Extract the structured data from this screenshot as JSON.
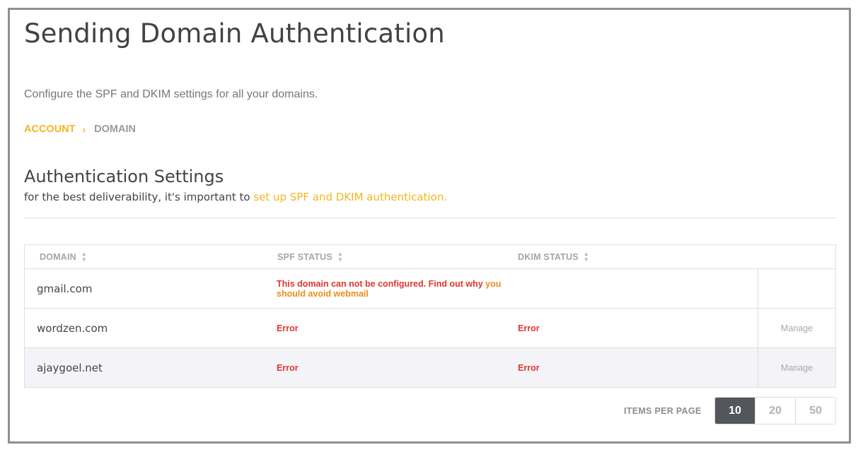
{
  "page": {
    "title": "Sending Domain Authentication",
    "subtitle": "Configure the SPF and DKIM settings for all your domains."
  },
  "breadcrumb": {
    "account": "ACCOUNT",
    "separator": "›",
    "current": "DOMAIN"
  },
  "section": {
    "title": "Authentication Settings",
    "desc_prefix": "for the best deliverability, it's important to ",
    "desc_link": "set up SPF and DKIM authentication."
  },
  "table": {
    "columns": [
      "DOMAIN",
      "SPF STATUS",
      "DKIM STATUS"
    ],
    "sort_icon": "sort-icon",
    "rows": [
      {
        "domain": "gmail.com",
        "spf_text": "This domain can not be configured. Find out why ",
        "spf_link": "you should avoid webmail",
        "dkim": "",
        "manage": ""
      },
      {
        "domain": "wordzen.com",
        "spf_text": "Error",
        "spf_link": "",
        "dkim": "Error",
        "manage": "Manage"
      },
      {
        "domain": "ajaygoel.net",
        "spf_text": "Error",
        "spf_link": "",
        "dkim": "Error",
        "manage": "Manage"
      }
    ]
  },
  "pagination": {
    "label": "ITEMS PER PAGE",
    "options": [
      "10",
      "20",
      "50"
    ],
    "selected": "10"
  },
  "colors": {
    "accent": "#f3b71e",
    "error": "#e0352f",
    "link_orange": "#e88f19",
    "active_button": "#53565a"
  }
}
